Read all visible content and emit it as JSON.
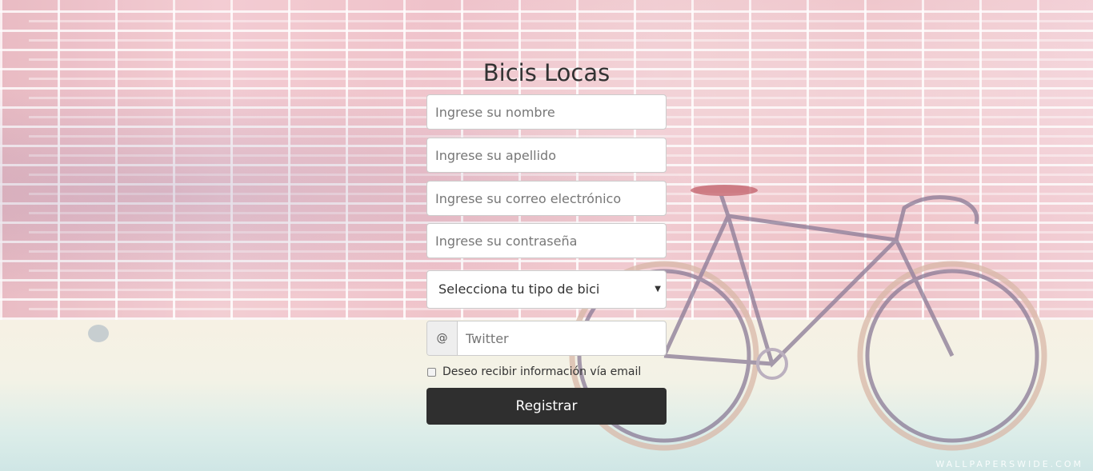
{
  "page": {
    "title": "Bicis Locas",
    "watermark": "WALLPAPERSWIDE.COM"
  },
  "form": {
    "name_placeholder": "Ingrese su nombre",
    "lastname_placeholder": "Ingrese su apellido",
    "email_placeholder": "Ingrese su correo electrónico",
    "password_placeholder": "Ingrese su contraseña",
    "bike_select": {
      "selected": "Selecciona tu tipo de bici",
      "caret": "▼"
    },
    "twitter": {
      "addon": "@",
      "placeholder": "Twitter"
    },
    "newsletter": {
      "label": "Deseo recibir información vía email",
      "checked": false
    },
    "submit_label": "Registrar"
  },
  "colors": {
    "button_bg": "#2f2f2f",
    "title_color": "#333333",
    "field_border": "#cccccc"
  }
}
